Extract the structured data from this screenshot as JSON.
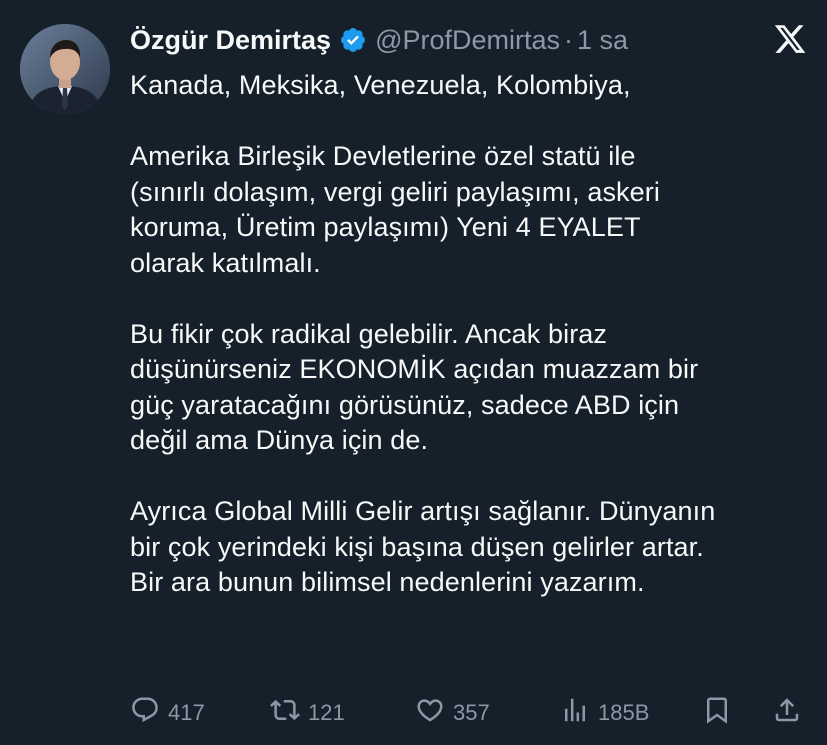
{
  "author": {
    "display_name": "Özgür Demirtaş",
    "handle": "@ProfDemirtas",
    "separator": "·",
    "time": "1 sa"
  },
  "icons": {
    "verified": "verified-badge-icon",
    "brand": "x-logo-icon",
    "reply": "reply-icon",
    "retweet": "retweet-icon",
    "like": "heart-icon",
    "views": "views-icon",
    "bookmark": "bookmark-icon",
    "share": "share-icon"
  },
  "colors": {
    "background": "#15202b",
    "text": "#f7f9f9",
    "muted": "#8b98a5",
    "verified": "#1d9bf0"
  },
  "tweet": {
    "paragraphs": [
      {
        "lines": [
          "Kanada, Meksika, Venezuela, Kolombiya,"
        ]
      },
      {
        "lines": [
          "Amerika Birleşik Devletlerine özel statü ile",
          "(sınırlı dolaşım,  vergi geliri paylaşımı, askeri",
          "koruma, Üretim paylaşımı) Yeni 4 EYALET",
          "olarak katılmalı."
        ]
      },
      {
        "lines": [
          "Bu fikir çok radikal gelebilir. Ancak biraz",
          "düşünürseniz EKONOMİK açıdan muazzam bir",
          "güç yaratacağını görüsünüz, sadece ABD için",
          "değil ama Dünya için de."
        ]
      },
      {
        "lines": [
          "Ayrıca Global Milli Gelir artışı sağlanır. Dünyanın",
          "bir çok yerindeki kişi başına düşen gelirler artar.",
          "Bir ara bunun bilimsel nedenlerini yazarım."
        ]
      }
    ]
  },
  "stats": {
    "replies": "417",
    "retweets": "121",
    "likes": "357",
    "views": "185B"
  }
}
